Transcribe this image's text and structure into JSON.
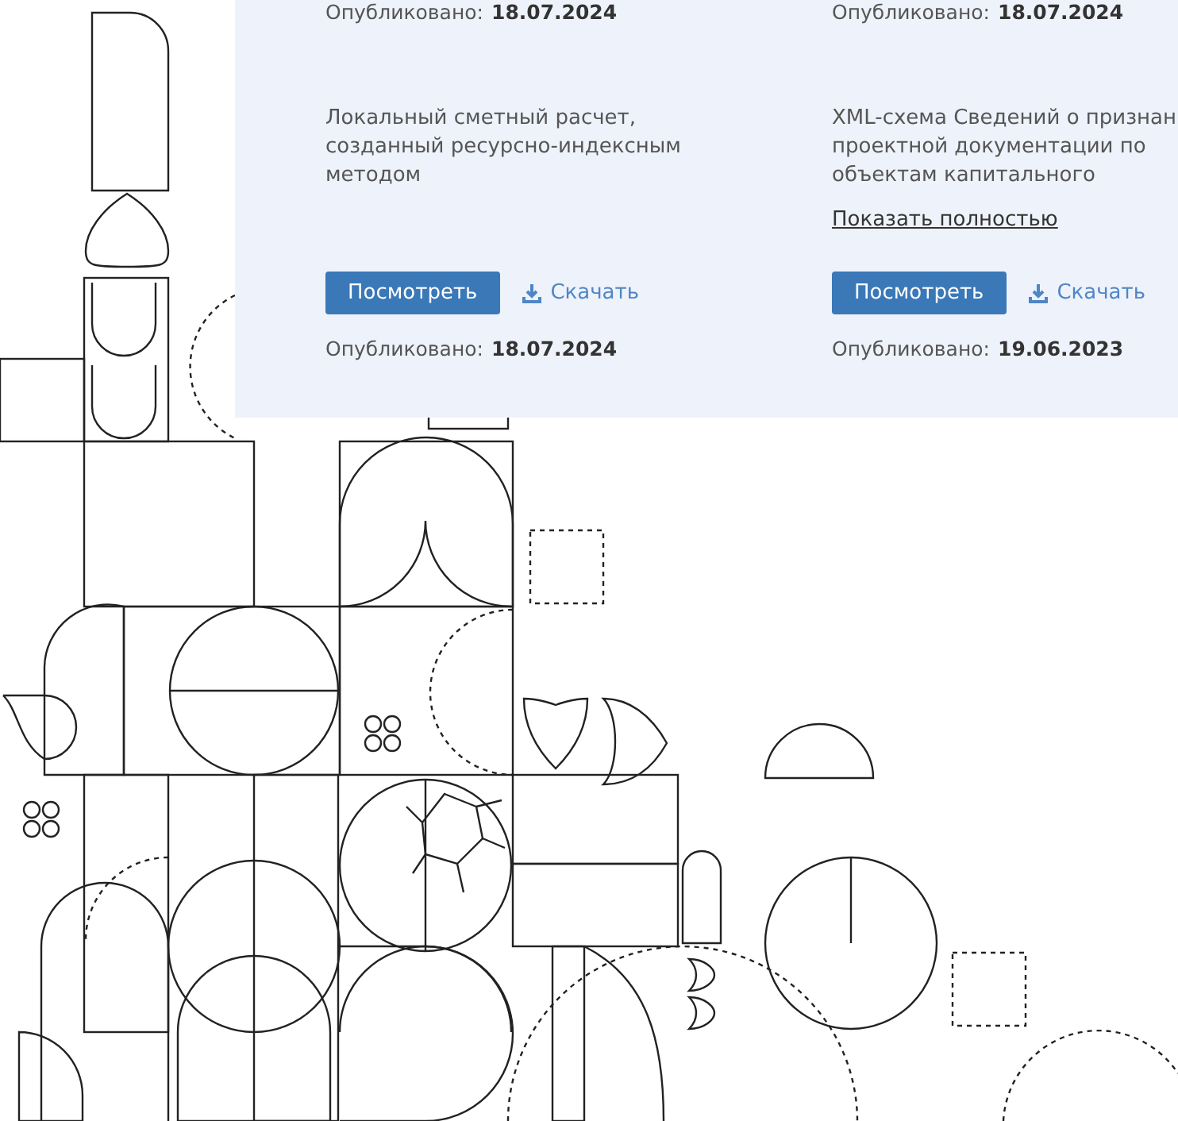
{
  "documents": [
    {
      "published_label": "Опубликовано:",
      "published_date": "18.07.2024"
    },
    {
      "published_label": "Опубликовано:",
      "published_date": "18.07.2024"
    },
    {
      "description": "Локальный сметный расчет,\nсозданный ресурсно-индексным\nметодом",
      "view_button": "Посмотреть",
      "download_link": "Скачать",
      "published_label": "Опубликовано:",
      "published_date": "18.07.2024"
    },
    {
      "description": "XML-схема Сведений о признан\nпроектной документации по\nобъектам капитального",
      "expand_link": "Показать полностью",
      "view_button": "Посмотреть",
      "download_link": "Скачать",
      "published_label": "Опубликовано:",
      "published_date": "19.06.2023"
    }
  ]
}
